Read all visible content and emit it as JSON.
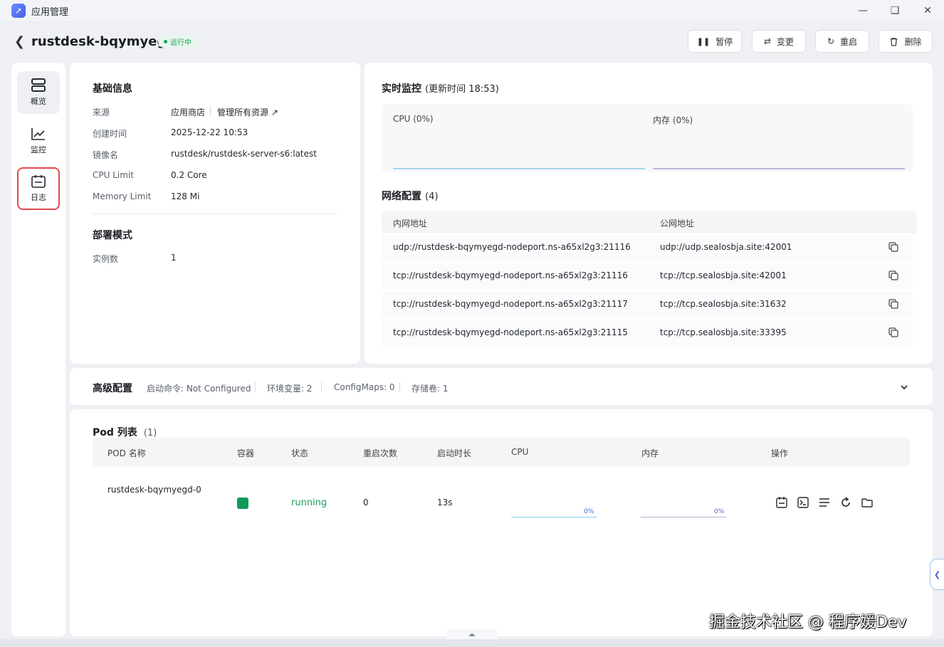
{
  "window": {
    "title": "应用管理"
  },
  "header": {
    "app_name": "rustdesk-bqymyegd",
    "status": "运行中",
    "buttons": {
      "pause": "暂停",
      "change": "变更",
      "restart": "重启",
      "delete": "删除"
    }
  },
  "sidebar": {
    "items": [
      {
        "label": "概览"
      },
      {
        "label": "监控"
      },
      {
        "label": "日志"
      }
    ]
  },
  "basic": {
    "title": "基础信息",
    "source_label": "来源",
    "source_value": "应用商店",
    "manage_link": "管理所有资源",
    "created_label": "创建时间",
    "created_value": "2025-12-22 10:53",
    "image_label": "镜像名",
    "image_value": "rustdesk/rustdesk-server-s6:latest",
    "cpu_label": "CPU Limit",
    "cpu_value": "0.2 Core",
    "mem_label": "Memory Limit",
    "mem_value": "128 Mi"
  },
  "deploy": {
    "title": "部署模式",
    "instances_label": "实例数",
    "instances_value": "1"
  },
  "monitor": {
    "title": "实时监控",
    "update_time": "(更新时间  18:53)",
    "cpu_label": "CPU  (0%)",
    "mem_label": "内存  (0%)"
  },
  "network": {
    "title": "网络配置",
    "count": "(4)",
    "col_internal": "内网地址",
    "col_public": "公网地址",
    "rows": [
      {
        "internal": "udp://rustdesk-bqymyegd-nodeport.ns-a65xl2g3:21116",
        "public": "udp://udp.sealosbja.site:42001"
      },
      {
        "internal": "tcp://rustdesk-bqymyegd-nodeport.ns-a65xl2g3:21116",
        "public": "tcp://tcp.sealosbja.site:42001"
      },
      {
        "internal": "tcp://rustdesk-bqymyegd-nodeport.ns-a65xl2g3:21117",
        "public": "tcp://tcp.sealosbja.site:31632"
      },
      {
        "internal": "tcp://rustdesk-bqymyegd-nodeport.ns-a65xl2g3:21115",
        "public": "tcp://tcp.sealosbja.site:33395"
      }
    ]
  },
  "advanced": {
    "title": "高级配置",
    "cmd": "启动命令: Not Configured",
    "env": "环境变量: 2",
    "configmaps": "ConfigMaps: 0",
    "volumes": "存储卷: 1"
  },
  "pods": {
    "title": "Pod 列表",
    "count": "(1)",
    "headers": {
      "name": "POD 名称",
      "container": "容器",
      "status": "状态",
      "restarts": "重启次数",
      "uptime": "启动时长",
      "cpu": "CPU",
      "mem": "内存",
      "ops": "操作"
    },
    "rows": [
      {
        "name": "rustdesk-bqymyegd-0",
        "status": "running",
        "restarts": "0",
        "uptime": "13s",
        "cpu": "0%",
        "mem": "0%"
      }
    ],
    "status_color": "#18a058"
  },
  "watermark": "掘金技术社区 @ 程序媛Dev",
  "colors": {
    "accent": "#3f5ee8",
    "running": "#18a058",
    "highlight": "#e5484d"
  }
}
